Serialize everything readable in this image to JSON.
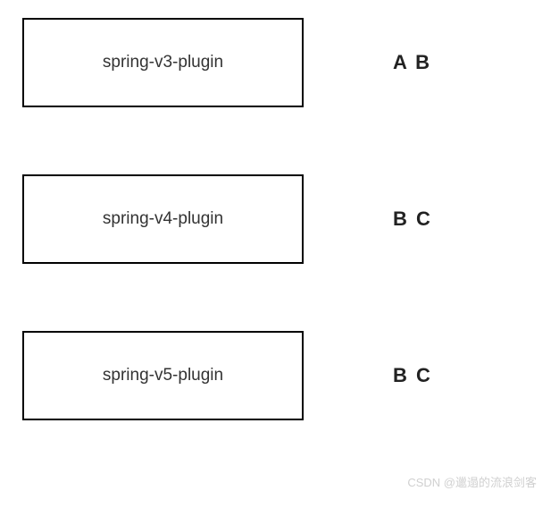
{
  "rows": [
    {
      "plugin": "spring-v3-plugin",
      "tags": "A B"
    },
    {
      "plugin": "spring-v4-plugin",
      "tags": "B C"
    },
    {
      "plugin": "spring-v5-plugin",
      "tags": "B C"
    }
  ],
  "watermark": "CSDN @邋遢的流浪剑客"
}
